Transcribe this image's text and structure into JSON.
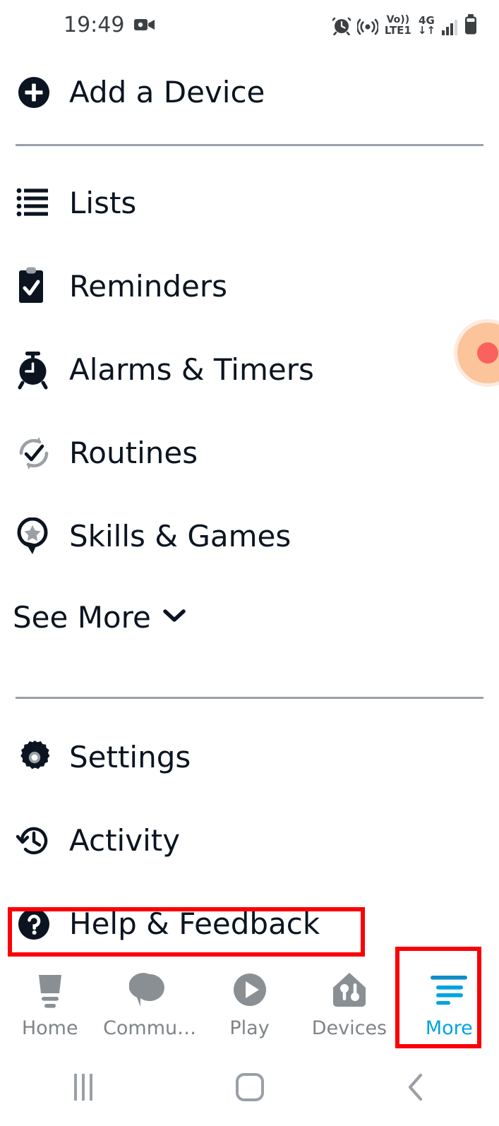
{
  "status_bar": {
    "time": "19:49",
    "left_icons": [
      {
        "name": "video-camera-icon"
      }
    ],
    "right_icons": [
      {
        "name": "alarm-clock-icon"
      },
      {
        "name": "hotspot-icon"
      },
      {
        "name": "volte-icon",
        "line1": "Vo))",
        "line2": "LTE1"
      },
      {
        "name": "mobile-data-icon",
        "line1": "4G",
        "line2": "↓↑"
      },
      {
        "name": "signal-bars-icon"
      },
      {
        "name": "battery-icon"
      }
    ]
  },
  "menu": {
    "add_device": {
      "label": "Add a Device",
      "icon": "add-circle-icon"
    },
    "primary_items": [
      {
        "label": "Lists",
        "icon": "list-icon"
      },
      {
        "label": "Reminders",
        "icon": "clipboard-check-icon"
      },
      {
        "label": "Alarms & Timers",
        "icon": "alarm-clock-icon"
      },
      {
        "label": "Routines",
        "icon": "routines-refresh-check-icon"
      },
      {
        "label": "Skills & Games",
        "icon": "skills-star-pin-icon"
      }
    ],
    "see_more": {
      "label": "See More",
      "icon": "chevron-down-icon"
    },
    "secondary_items": [
      {
        "label": "Settings",
        "icon": "gear-icon"
      },
      {
        "label": "Activity",
        "icon": "history-clock-icon"
      },
      {
        "label": "Help & Feedback",
        "icon": "question-circle-icon"
      }
    ]
  },
  "bottom_nav": {
    "tabs": [
      {
        "label": "Home",
        "icon": "echo-speaker-icon",
        "active": false
      },
      {
        "label": "Commu…",
        "icon": "speech-bubble-icon",
        "active": false
      },
      {
        "label": "Play",
        "icon": "play-circle-icon",
        "active": false
      },
      {
        "label": "Devices",
        "icon": "house-devices-icon",
        "active": false
      },
      {
        "label": "More",
        "icon": "hamburger-lines-icon",
        "active": true
      }
    ]
  },
  "system_nav": {
    "recents": "recents-icon",
    "home": "home-square-icon",
    "back": "back-chevron-icon"
  },
  "overlay": {
    "floating_indicator": "floating-record-indicator"
  },
  "highlights": [
    {
      "name": "help-feedback-highlight",
      "color": "#fb0007"
    },
    {
      "name": "more-tab-highlight",
      "color": "#fb0007"
    }
  ],
  "colors": {
    "text_primary": "#0b1420",
    "muted": "#7f8487",
    "accent_blue": "#00a3e0",
    "highlight_red": "#fb0007",
    "divider": "#9aa0a6"
  }
}
